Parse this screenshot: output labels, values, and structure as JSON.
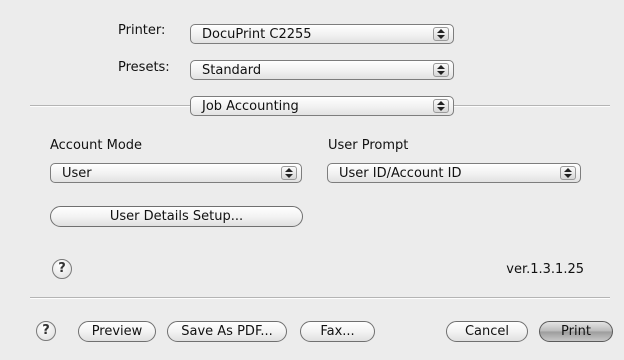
{
  "printer": {
    "label": "Printer:",
    "value": "DocuPrint C2255"
  },
  "presets": {
    "label": "Presets:",
    "value": "Standard"
  },
  "panel": {
    "value": "Job Accounting"
  },
  "account_mode": {
    "label": "Account Mode",
    "value": "User"
  },
  "user_prompt": {
    "label": "User Prompt",
    "value": "User ID/Account ID"
  },
  "user_details_button": {
    "label": "User Details Setup..."
  },
  "help_icon": {
    "glyph": "?"
  },
  "version": "ver.1.3.1.25",
  "footer": {
    "preview": "Preview",
    "save_pdf": "Save As PDF...",
    "fax": "Fax...",
    "cancel": "Cancel",
    "print": "Print"
  }
}
